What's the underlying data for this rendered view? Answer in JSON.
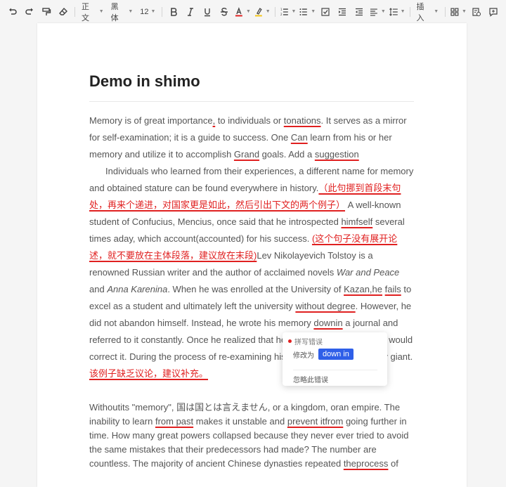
{
  "toolbar": {
    "style_label": "正文",
    "font_label": "黑体",
    "size_label": "12",
    "insert_label": "插入",
    "icons": [
      "undo-icon",
      "redo-icon",
      "format-painter-icon",
      "clear-format-icon",
      "bold-icon",
      "italic-icon",
      "underline-icon",
      "strikethrough-icon",
      "text-color-icon",
      "highlight-icon",
      "ordered-list-icon",
      "bullet-list-icon",
      "checklist-icon",
      "indent-icon",
      "outdent-icon",
      "align-icon",
      "line-spacing-icon",
      "table-icon",
      "history-icon",
      "comment-icon"
    ],
    "colors": {
      "text_color_bar": "#e02020",
      "highlight_bar": "#f5c518"
    }
  },
  "doc": {
    "title": "Demo in shimo",
    "p1": {
      "s1": "Memory is of great importance",
      "e1": ",",
      "s2": " to individuals or ",
      "e2": "tonations",
      "s3": ". It serves as a mirror for self-examination; it is a guide to success. One ",
      "e3": "Can",
      "s4": " learn from his or her memory and utilize it to accomplish ",
      "e4": "Grand",
      "s5": " goals. Add a ",
      "e5": "suggestion"
    },
    "p2": {
      "s1": "Individuals who learned from their experiences, a different name for memory and obtained stature can be found everywhere in history.",
      "c1": "（此句挪到首段末句处，再来个递进，对国家更是如此，然后引出下文的两个例子）",
      "s2": " A well-known student of Confucius, Mencius, once said that he introspected ",
      "e1": "himfself",
      "s3": " several times aday, which account(accounted) for his success. ",
      "c2": "(这个句子没有展开论述，就不要放在主体段落，建议放在末段)",
      "s4": "Lev Nikolayevich Tolstoy is a renowned Russian writer and the author of acclaimed novels ",
      "i1": "War and Peace",
      "s5": " and ",
      "i2": "Anna Karenina",
      "s6": ". When he was enrolled at the University of ",
      "e2": "Kazan,he",
      "s7": " ",
      "e3": "fails",
      "s8": " to excel as a student and ultimately left the university ",
      "e4": "without degree",
      "s9": ". However, he did not abandon himself. Instead, he wrote his memory ",
      "e5": "downin",
      "s10": " a journal and referred to it constantly. Once he realized that he had made a mistake, he would correct it. During the process of re-examining his life, he became a literary giant.",
      "c3": "该例子缺乏议论，建议补充。"
    },
    "p3": {
      "s1": "Withoutits \"memory\", ",
      "j1": "国は国とは言えません",
      "s2": ", or a kingdom, oran empire. The inability to learn ",
      "e1": "from past",
      "s3": " makes it unstable and ",
      "e2": "prevent itfrom",
      "s4": " going further in time. How many great powers collapsed because they never ever tried to avoid the same mistakes that their predecessors had made? The number are countless. The majority of ancient Chinese dynasties repeated ",
      "e3": "theprocess",
      "s5": " of"
    }
  },
  "popup": {
    "header": "拼写错误",
    "change_label": "修改为",
    "suggestion": "down in",
    "ignore": "忽略此错误",
    "colors": {
      "accent": "#2f5fe8",
      "error": "#e02020"
    }
  }
}
